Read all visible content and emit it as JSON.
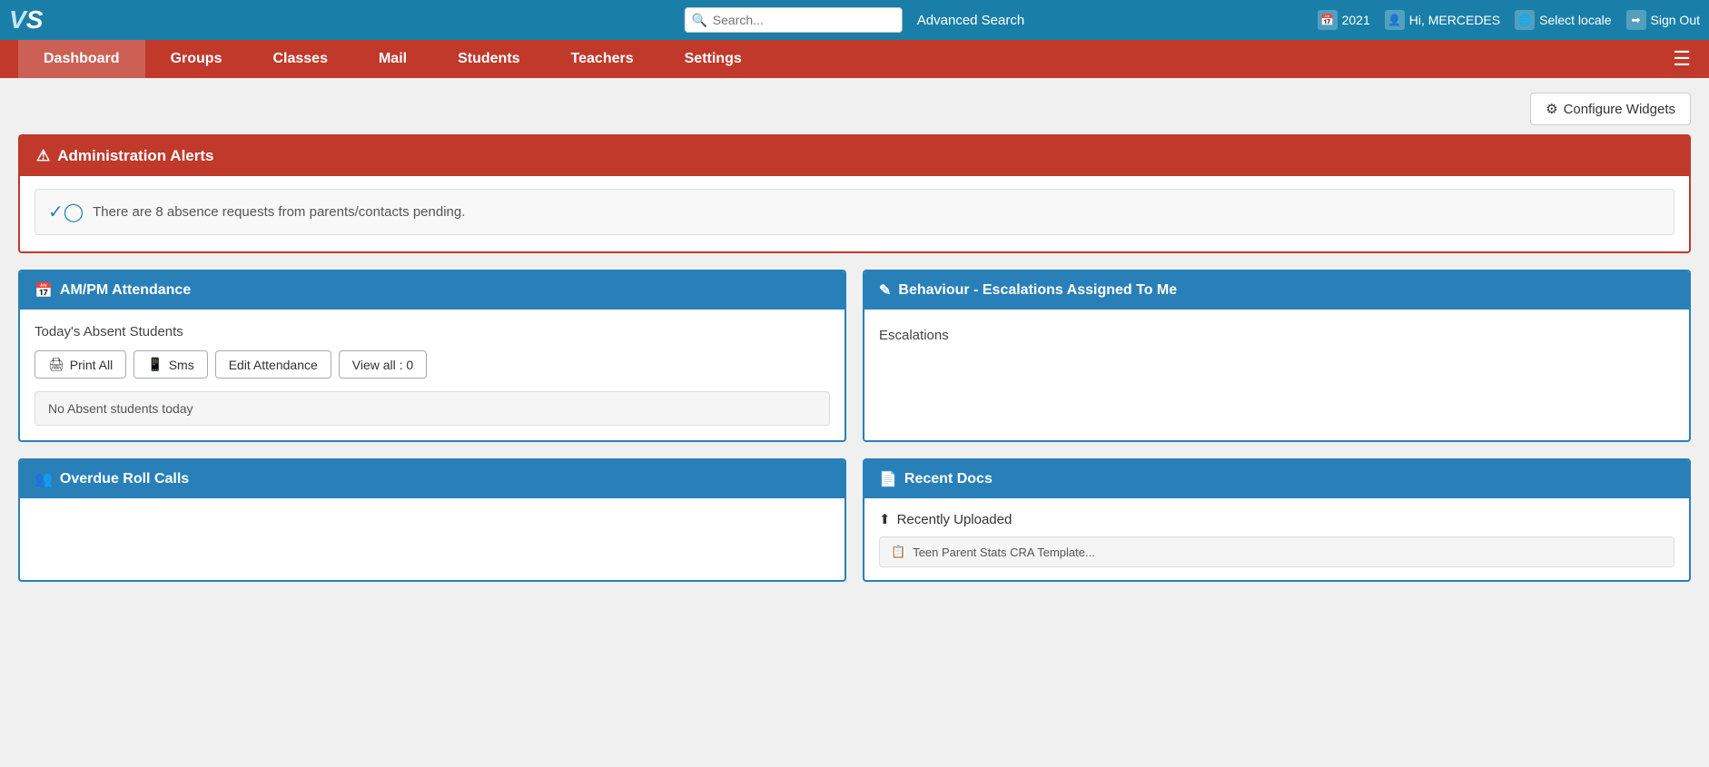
{
  "topbar": {
    "logo": "VS",
    "search": {
      "placeholder": "Search...",
      "value": ""
    },
    "advanced_search_label": "Advanced Search",
    "year": "2021",
    "user_greeting": "Hi, MERCEDES",
    "select_locale_label": "Select locale",
    "sign_out_label": "Sign Out"
  },
  "navbar": {
    "items": [
      {
        "label": "Dashboard",
        "active": true
      },
      {
        "label": "Groups",
        "active": false
      },
      {
        "label": "Classes",
        "active": false
      },
      {
        "label": "Mail",
        "active": false
      },
      {
        "label": "Students",
        "active": false
      },
      {
        "label": "Teachers",
        "active": false
      },
      {
        "label": "Settings",
        "active": false
      }
    ]
  },
  "configure_widgets": {
    "label": "Configure Widgets",
    "icon": "⚙"
  },
  "alerts": {
    "header": "Administration Alerts",
    "items": [
      {
        "text": "There are 8 absence requests from parents/contacts pending."
      }
    ]
  },
  "widgets": {
    "attendance": {
      "header": "AM/PM Attendance",
      "label": "Today's Absent Students",
      "buttons": [
        {
          "label": "Print All",
          "icon": "🖨"
        },
        {
          "label": "Sms",
          "icon": "📱"
        },
        {
          "label": "Edit Attendance"
        },
        {
          "label": "View all : 0"
        }
      ],
      "no_absent_text": "No Absent students today"
    },
    "behaviour": {
      "header": "Behaviour - Escalations Assigned To Me",
      "escalations_label": "Escalations"
    },
    "overdue": {
      "header": "Overdue Roll Calls"
    },
    "recent_docs": {
      "header": "Recent Docs",
      "recently_uploaded_label": "Recently Uploaded",
      "doc_item_text": "Teen Parent Stats CRA Template..."
    }
  }
}
